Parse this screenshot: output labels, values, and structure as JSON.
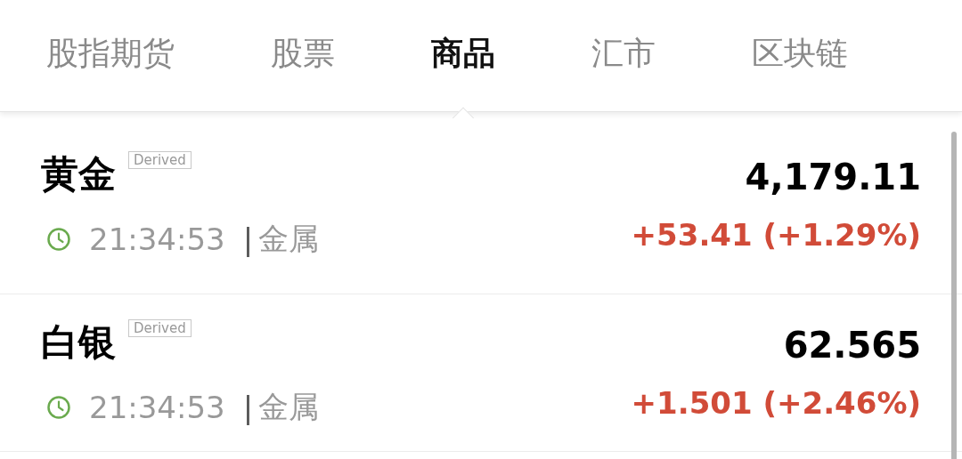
{
  "tabs": [
    {
      "label": "股指期货",
      "selected": false
    },
    {
      "label": "股票",
      "selected": false
    },
    {
      "label": "商品",
      "selected": true
    },
    {
      "label": "汇市",
      "selected": false
    },
    {
      "label": "区块链",
      "selected": false
    }
  ],
  "quotes": [
    {
      "name": "黄金",
      "badge": "Derived",
      "time": "21:34:53",
      "separator": "|",
      "category": "金属",
      "price": "4,179.11",
      "change": "+53.41 (+1.29%)",
      "rising": true
    },
    {
      "name": "白银",
      "badge": "Derived",
      "time": "21:34:53",
      "separator": "|",
      "category": "金属",
      "price": "62.565",
      "change": "+1.501 (+2.46%)",
      "rising": true
    }
  ]
}
